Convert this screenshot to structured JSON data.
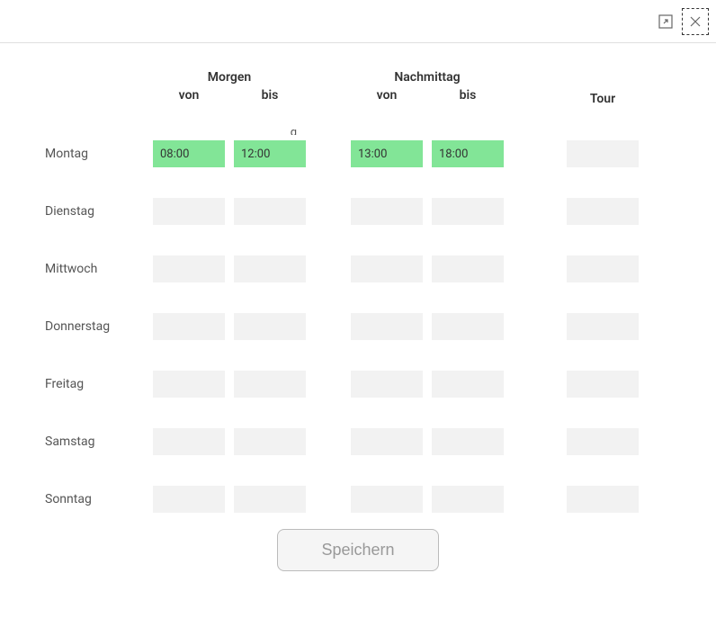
{
  "headers": {
    "morning": "Morgen",
    "afternoon": "Nachmittag",
    "from": "von",
    "to": "bis",
    "tour": "Tour"
  },
  "days": [
    {
      "label": "Montag",
      "morning_from": "08:00",
      "morning_to": "12:00",
      "afternoon_from": "13:00",
      "afternoon_to": "18:00",
      "tour": ""
    },
    {
      "label": "Dienstag",
      "morning_from": "",
      "morning_to": "",
      "afternoon_from": "",
      "afternoon_to": "",
      "tour": ""
    },
    {
      "label": "Mittwoch",
      "morning_from": "",
      "morning_to": "",
      "afternoon_from": "",
      "afternoon_to": "",
      "tour": ""
    },
    {
      "label": "Donnerstag",
      "morning_from": "",
      "morning_to": "",
      "afternoon_from": "",
      "afternoon_to": "",
      "tour": ""
    },
    {
      "label": "Freitag",
      "morning_from": "",
      "morning_to": "",
      "afternoon_from": "",
      "afternoon_to": "",
      "tour": ""
    },
    {
      "label": "Samstag",
      "morning_from": "",
      "morning_to": "",
      "afternoon_from": "",
      "afternoon_to": "",
      "tour": ""
    },
    {
      "label": "Sonntag",
      "morning_from": "",
      "morning_to": "",
      "afternoon_from": "",
      "afternoon_to": "",
      "tour": ""
    }
  ],
  "save_label": "Speichern"
}
